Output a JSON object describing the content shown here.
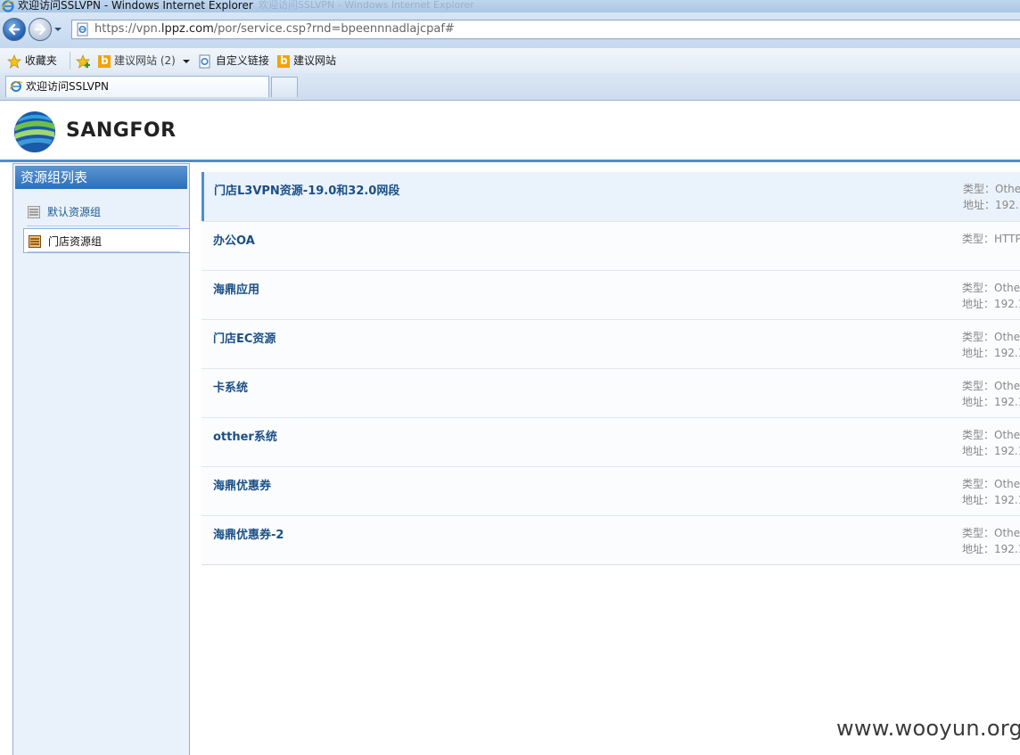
{
  "window": {
    "title": "欢迎访问SSLVPN - Windows Internet Explorer",
    "ghost_title": "欢迎访问SSLVPN - Windows Internet Explorer"
  },
  "address_bar": {
    "url_prefix": "https://vpn.",
    "url_domain": "lppz.com",
    "url_suffix": "/por/service.csp?rnd=bpeennnadlajcpaf#"
  },
  "favorites_bar": {
    "favorites_label": "收藏夹",
    "suggested_sites_label": "建议网站 (2)",
    "custom_links_label": "自定义链接",
    "suggested_site_label": "建议网站"
  },
  "tabs": [
    {
      "label": "欢迎访问SSLVPN"
    }
  ],
  "header": {
    "logo_text": "SANGFOR"
  },
  "sidebar": {
    "title": "资源组列表",
    "items": [
      {
        "label": "默认资源组",
        "active": false
      },
      {
        "label": "门店资源组",
        "active": true
      }
    ]
  },
  "resources": [
    {
      "name": "门店L3VPN资源-19.0和32.0网段",
      "type": "类型：Othe",
      "address": "地址：192.1"
    },
    {
      "name": "办公OA",
      "type": "类型：HTTP",
      "address": ""
    },
    {
      "name": "海鼎应用",
      "type": "类型：Othe",
      "address": "地址：192.1"
    },
    {
      "name": "门店EC资源",
      "type": "类型：Othe",
      "address": "地址：192.1"
    },
    {
      "name": "卡系统",
      "type": "类型：Othe",
      "address": "地址：192.1"
    },
    {
      "name": "otther系统",
      "type": "类型：Othe",
      "address": "地址：192.1"
    },
    {
      "name": "海鼎优惠券",
      "type": "类型：Othe",
      "address": "地址：192.1"
    },
    {
      "name": "海鼎优惠券-2",
      "type": "类型：Othe",
      "address": "地址：192.1"
    }
  ],
  "watermark": "www.wooyun.org",
  "colors": {
    "accent": "#4b8fd1",
    "sidebar_title_bg": "#2e6fb7",
    "resource_name": "#1b4f86",
    "bing_orange": "#f2a400"
  },
  "icons": {
    "ie_logo": "ie-logo-icon",
    "back": "back-arrow-icon",
    "forward": "forward-arrow-icon",
    "favorites": "star-icon",
    "add_favorites": "add-favorite-icon",
    "bing": "bing-icon",
    "page": "page-icon",
    "group": "resource-group-icon"
  }
}
